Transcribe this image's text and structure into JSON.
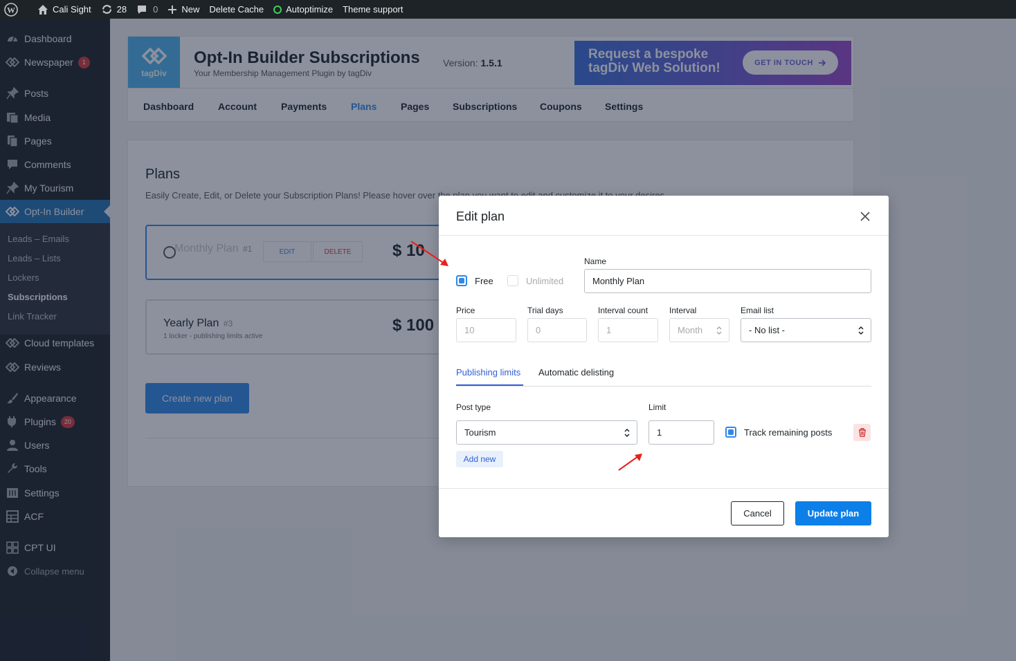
{
  "admin_bar": {
    "site_name": "Cali Sight",
    "updates_count": "28",
    "comments_count": "0",
    "new_label": "New",
    "delete_cache": "Delete Cache",
    "autoptimize": "Autoptimize",
    "theme_support": "Theme support"
  },
  "sidebar": {
    "items": [
      {
        "label": "Dashboard",
        "icon": "dashboard-icon"
      },
      {
        "label": "Newspaper",
        "icon": "tagdiv-icon",
        "badge": "1"
      },
      {
        "label": "Posts",
        "icon": "pin-icon"
      },
      {
        "label": "Media",
        "icon": "media-icon"
      },
      {
        "label": "Pages",
        "icon": "pages-icon"
      },
      {
        "label": "Comments",
        "icon": "comments-icon"
      },
      {
        "label": "My Tourism",
        "icon": "pin-icon"
      },
      {
        "label": "Opt-In Builder",
        "icon": "tagdiv-icon"
      },
      {
        "label": "Cloud templates",
        "icon": "tagdiv-icon"
      },
      {
        "label": "Reviews",
        "icon": "tagdiv-icon"
      },
      {
        "label": "Appearance",
        "icon": "brush-icon"
      },
      {
        "label": "Plugins",
        "icon": "plugin-icon",
        "badge": "20"
      },
      {
        "label": "Users",
        "icon": "user-icon"
      },
      {
        "label": "Tools",
        "icon": "wrench-icon"
      },
      {
        "label": "Settings",
        "icon": "settings-icon"
      },
      {
        "label": "ACF",
        "icon": "grid-icon"
      },
      {
        "label": "CPT UI",
        "icon": "grid-icon"
      },
      {
        "label": "Collapse menu",
        "icon": "collapse-icon"
      }
    ],
    "submenu": [
      "Leads – Emails",
      "Leads – Lists",
      "Lockers",
      "Subscriptions",
      "Link Tracker"
    ]
  },
  "plugin_header": {
    "logo_text": "tagDiv",
    "title": "Opt-In Builder Subscriptions",
    "subtitle": "Your Membership Management Plugin by tagDiv",
    "version_label": "Version:",
    "version_value": "1.5.1",
    "promo_line1": "Request a bespoke",
    "promo_line2": "tagDiv Web Solution!",
    "promo_button": "GET IN TOUCH",
    "tabs": [
      "Dashboard",
      "Account",
      "Payments",
      "Plans",
      "Pages",
      "Subscriptions",
      "Coupons",
      "Settings"
    ],
    "active_tab": "Plans"
  },
  "plans_page": {
    "heading": "Plans",
    "description": "Easily Create, Edit, or Delete your Subscription Plans! Please hover over the plan you want to edit and customize it to your desires.",
    "plans": [
      {
        "name": "Monthly Plan",
        "number": "#1",
        "price": "$ 10",
        "edit": "EDIT",
        "delete": "DELETE"
      },
      {
        "name": "Yearly Plan",
        "number": "#3",
        "meta": "1 locker - publishing limits active",
        "price": "$ 100"
      }
    ],
    "create_button": "Create new plan"
  },
  "modal": {
    "title": "Edit plan",
    "free_label": "Free",
    "unlimited_label": "Unlimited",
    "name_label": "Name",
    "name_value": "Monthly Plan",
    "price_label": "Price",
    "price_value": "10",
    "trial_label": "Trial days",
    "trial_value": "0",
    "interval_count_label": "Interval count",
    "interval_count_value": "1",
    "interval_label": "Interval",
    "interval_value": "Month",
    "email_list_label": "Email list",
    "email_list_value": "- No list -",
    "tabs": [
      "Publishing limits",
      "Automatic delisting"
    ],
    "post_type_label": "Post type",
    "post_type_value": "Tourism",
    "limit_label": "Limit",
    "limit_value": "1",
    "track_label": "Track remaining posts",
    "add_new": "Add new",
    "cancel": "Cancel",
    "update": "Update plan"
  },
  "colors": {
    "accent": "#2f88e8",
    "primary_button": "#0d7fe8",
    "annotation_arrow": "#e8201c"
  }
}
